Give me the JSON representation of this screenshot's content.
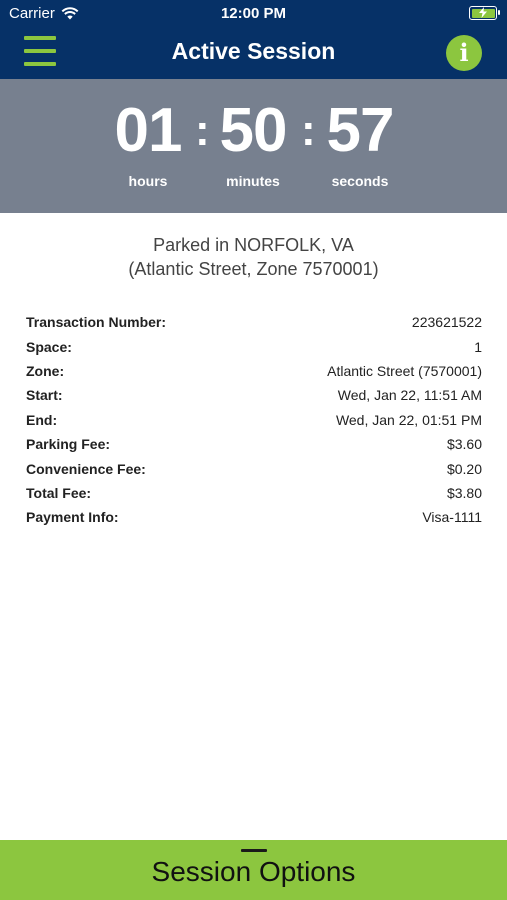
{
  "status_bar": {
    "carrier": "Carrier",
    "time": "12:00 PM"
  },
  "nav": {
    "title": "Active Session",
    "menu_icon": "hamburger-menu-icon",
    "info_icon": "info-icon",
    "info_glyph": "i"
  },
  "timer": {
    "hours": "01",
    "minutes": "50",
    "seconds": "57",
    "hours_label": "hours",
    "minutes_label": "minutes",
    "seconds_label": "seconds"
  },
  "location": {
    "line1": "Parked in NORFOLK, VA",
    "line2": "(Atlantic Street, Zone 7570001)"
  },
  "details": [
    {
      "label": "Transaction Number:",
      "value": "223621522"
    },
    {
      "label": "Space:",
      "value": "1"
    },
    {
      "label": "Zone:",
      "value": "Atlantic Street (7570001)"
    },
    {
      "label": "Start:",
      "value": "Wed, Jan 22, 11:51 AM"
    },
    {
      "label": "End:",
      "value": "Wed, Jan 22, 01:51 PM"
    },
    {
      "label": "Parking Fee:",
      "value": "$3.60"
    },
    {
      "label": "Convenience Fee:",
      "value": "$0.20"
    },
    {
      "label": "Total Fee:",
      "value": "$3.80"
    },
    {
      "label": "Payment Info:",
      "value": "Visa-1111"
    }
  ],
  "bottom": {
    "label": "Session Options"
  },
  "colors": {
    "nav_background": "#063167",
    "accent_green": "#8cc63f",
    "timer_background": "#77808f"
  }
}
